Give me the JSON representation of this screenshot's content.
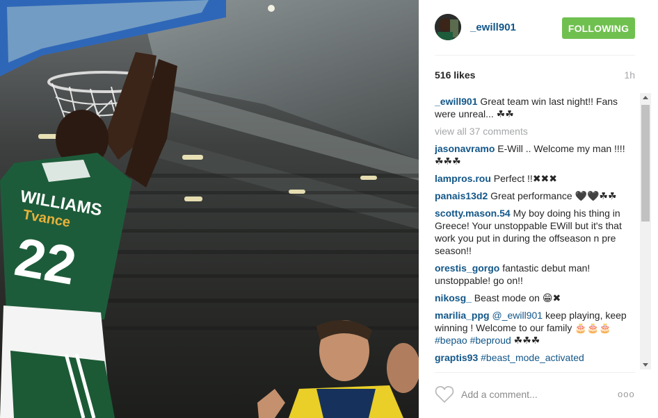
{
  "post": {
    "photo": {
      "jersey_name": "WILLIAMS",
      "jersey_sponsor": "Tvance",
      "jersey_number": "22"
    },
    "author": {
      "username": "_ewill901"
    },
    "follow_label": "FOLLOWING",
    "likes": "516 likes",
    "time": "1h",
    "caption": {
      "user": "_ewill901",
      "text": "Great team win last night!! Fans were unreal... ☘☘"
    },
    "view_all": "view all 37 comments",
    "comments": [
      {
        "user": "jasonavramo",
        "text": "E-Will .. Welcome my man !!!!☘☘☘"
      },
      {
        "user": "lampros.rou",
        "text": "Perfect !!✖✖✖"
      },
      {
        "user": "panais13d2",
        "text": "Great performance 🖤🖤☘☘"
      },
      {
        "user": "scotty.mason.54",
        "text": "My boy doing his thing in Greece! Your unstoppable EWill but it's that work you put in during the offseason n pre season!!"
      },
      {
        "user": "orestis_gorgo",
        "text": "fantastic debut man! unstoppable! go on!!"
      },
      {
        "user": "nikosg_",
        "text": "Beast mode on 😁✖"
      },
      {
        "user": "marilia_ppg",
        "mention": "@_ewill901",
        "text": "keep playing, keep winning ! Welcome to our family 🎂🎂🎂",
        "tag1": "#bepao",
        "tag2": "#beproud",
        "tail": "☘☘☘"
      },
      {
        "user": "graptis93",
        "tag1": "#beast_mode_activated"
      }
    ],
    "add_comment_placeholder": "Add a comment...",
    "more_label": "ooo"
  },
  "colors": {
    "follow_bg": "#70c050",
    "username": "#125688",
    "muted": "#a5a7aa",
    "jersey": "#1d5c3a"
  },
  "icons": {
    "heart": "heart-outline-icon",
    "more": "more-options-icon"
  }
}
